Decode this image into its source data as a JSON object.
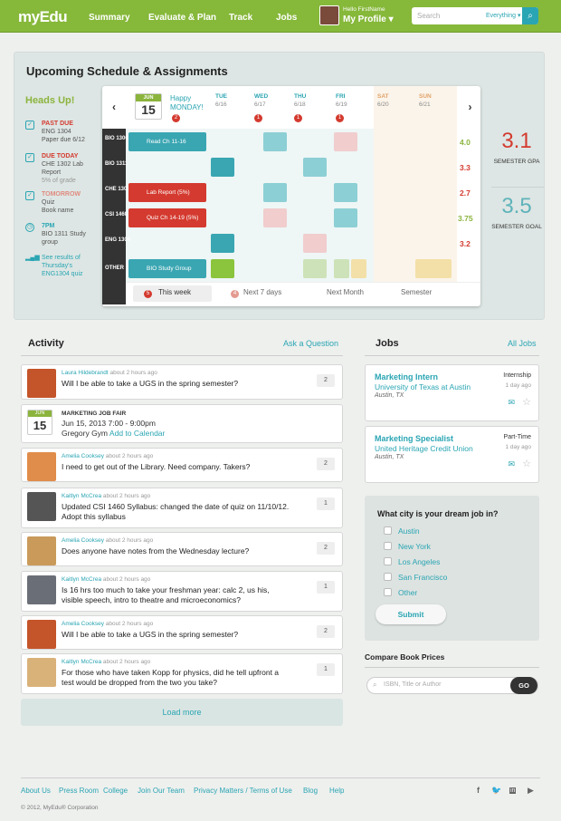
{
  "nav": {
    "logo": "myEdu",
    "links": [
      "Summary",
      "Evaluate & Plan",
      "Track",
      "Jobs"
    ],
    "hello": "Hello FirstName",
    "profile": "My Profile ▾",
    "search_placeholder": "Search",
    "search_scope": "Everything ▾"
  },
  "schedule": {
    "title": "Upcoming Schedule & Assignments",
    "headsup": "Heads Up!",
    "items": [
      {
        "label": "PAST DUE",
        "lines": [
          "ENG 1304",
          "Paper due 6/12"
        ]
      },
      {
        "label": "DUE TODAY",
        "lines": [
          "CHE 1302 Lab",
          "Report",
          "5% of grade"
        ]
      },
      {
        "label": "TOMORROW",
        "lines": [
          "Quiz",
          "Book name"
        ]
      },
      {
        "label": "7PM",
        "lines": [
          "BIO 1311 Study",
          "group"
        ]
      },
      {
        "label": "",
        "lines": [
          "See results of",
          "Thursday's",
          "ENG1304 quiz"
        ]
      }
    ],
    "today_month": "JUN",
    "today_day": "15",
    "today_text": "Happy MONDAY!",
    "today_badge": "2",
    "days": [
      {
        "n": "TUE",
        "d": "6/16",
        "b": ""
      },
      {
        "n": "WED",
        "d": "6/17",
        "b": "1"
      },
      {
        "n": "THU",
        "d": "6/18",
        "b": "1"
      },
      {
        "n": "FRI",
        "d": "6/19",
        "b": "1"
      },
      {
        "n": "SAT",
        "d": "6/20",
        "b": ""
      },
      {
        "n": "SUN",
        "d": "6/21",
        "b": ""
      }
    ],
    "rows": [
      "BIO 1306",
      "BIO 1311",
      "CHE 1302",
      "CSI 1460",
      "ENG 1304",
      "OTHER"
    ],
    "events": [
      "Read Ch 11-16",
      "Lab Report (5%)",
      "Quiz Ch 14-19 (5%)",
      "BIO Study Group"
    ],
    "grades": [
      "4.0",
      "3.3",
      "2.7",
      "3.75",
      "3.2",
      ""
    ],
    "gpa": "3.1",
    "gpa_label": "SEMESTER GPA",
    "goal": "3.5",
    "goal_label": "SEMESTER GOAL",
    "tabs": [
      {
        "badge": "5",
        "label": "This week"
      },
      {
        "badge": "4",
        "label": "Next 7 days"
      },
      {
        "badge": "",
        "label": "Next Month"
      },
      {
        "badge": "",
        "label": "Semester"
      }
    ]
  },
  "activity": {
    "title": "Activity",
    "link": "Ask a Question",
    "items": [
      {
        "who": "Laura Hildebrandt",
        "ago": " about 2 hours ago",
        "msg": "Will I be able to take a UGS in the spring semester?",
        "count": "2"
      },
      {
        "who": "Amelia Cooksey",
        "ago": " about 2 hours ago",
        "msg": "I need to get out of the Library. Need company. Takers?",
        "count": "2"
      },
      {
        "who": "Kaitlyn McCrea",
        "ago": " about 2 hours ago",
        "msg": "Updated CSI 1460 Syllabus: changed the date of quiz on 11/10/12. Adopt this syllabus",
        "count": "1"
      },
      {
        "who": "Amelia Cooksey",
        "ago": " about 2 hours ago",
        "msg": "Does anyone have notes from the Wednesday lecture?",
        "count": "2"
      },
      {
        "who": "Kaitlyn McCrea",
        "ago": " about 2 hours ago",
        "msg": "Is 16 hrs too much to take your freshman year: calc 2, us his, visible speech, intro to theatre and microeconomics?",
        "count": "1"
      },
      {
        "who": "Amelia Cooksey",
        "ago": " about 2 hours ago",
        "msg": "Will I be able to take a UGS in the spring semester?",
        "count": "2"
      },
      {
        "who": "Kaitlyn McCrea",
        "ago": " about 2 hours ago",
        "msg": "For those who have taken Kopp for physics, did he tell upfront a test would be dropped from the two you take?",
        "count": "1"
      }
    ],
    "fair": {
      "month": "JUN",
      "day": "15",
      "title": "MARKETING JOB FAIR",
      "when": "Jun 15, 2013  7:00 - 9:00pm",
      "where": "Gregory Gym",
      "add": "Add to Calendar"
    },
    "load": "Load more"
  },
  "jobs": {
    "title": "Jobs",
    "link": "All Jobs",
    "items": [
      {
        "title": "Marketing Intern",
        "company": "University of Texas at Austin",
        "loc": "Austin, TX",
        "type": "Internship",
        "ago": "1 day ago"
      },
      {
        "title": "Marketing Specialist",
        "company": "United Heritage Credit Union",
        "loc": "Austin, TX",
        "type": "Part-Time",
        "ago": "1 day ago"
      }
    ]
  },
  "poll": {
    "question": "What city is your dream job in?",
    "options": [
      "Austin",
      "New York",
      "Los Angeles",
      "San Francisco",
      "Other"
    ],
    "submit": "Submit"
  },
  "books": {
    "title": "Compare Book Prices",
    "placeholder": "ISBN, Title or Author",
    "go": "GO"
  },
  "footer": {
    "links": [
      "About Us",
      "Press Room",
      "College",
      "Join Our Team",
      "Privacy Matters / Terms of Use",
      "Blog",
      "Help"
    ],
    "copy": "© 2012, MyEdu® Corporation"
  }
}
